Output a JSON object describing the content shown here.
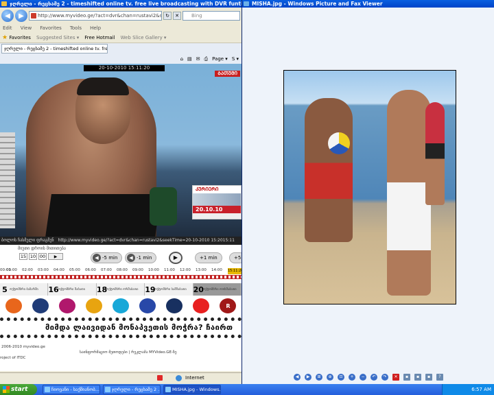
{
  "ie": {
    "title": "ჯღრელი - რეცხამე 2 - timeshifted online tv. free live broadcasting with DVR funtionality myvid - Windows Internet Explorer",
    "url": "http://www.myvideo.ge/?act=dvr&chan=rustavi2&seekTi",
    "search_placeholder": "Bing",
    "menu": [
      "Edit",
      "View",
      "Favorites",
      "Tools",
      "Help"
    ],
    "favorites_label": "Favorites",
    "fav_links": [
      "Suggested Sites ▾",
      "Free Hotmail",
      "Web Slice Gallery ▾"
    ],
    "tab_title": "ჯღრელი - რეცხამე 2 - timeshifted online tv. free live ...",
    "cmd": [
      "Page ▾",
      "S ▾"
    ],
    "status_zone": "Internet"
  },
  "player": {
    "timestamp": "20-10-2010  15:11:20",
    "badge": "ᲑᲐᲗᲣᲛᲘ",
    "corner_top": "ᲙᲣᲠᲘᲔᲠᲘ",
    "corner_date": "20.10.10",
    "ctrl_text": "ბოლოს ჩასმული ფრაგმენ",
    "ctrl_url": "http://www.myvideo.ge/?act=dvr&chan=rustavi2&seekTime=20-10-2010 15:2015:11",
    "time_label": "მიუთი დროის მითითება",
    "time_h": "15",
    "time_m": "10",
    "time_s": "00",
    "go": "▶",
    "btn_m5": "-5 min",
    "btn_m1": "-1 min",
    "btn_p1": "+1 min",
    "btn_p5": "+5"
  },
  "timeline": {
    "labels": [
      "00:00",
      "01:00",
      "02:00",
      "03:00",
      "04:00",
      "05:00",
      "06:00",
      "07:00",
      "08:00",
      "09:00",
      "10:00",
      "11:00",
      "12:00",
      "13:00",
      "14:00"
    ],
    "current": "15:11:20"
  },
  "programs": [
    {
      "num": "5",
      "text": "ოქტომბრი ბაზარში"
    },
    {
      "num": "16",
      "text": "ოქტომბრი შაბათი"
    },
    {
      "num": "18",
      "text": "ოქტომბრი ორშაბათი"
    },
    {
      "num": "19",
      "text": "ოქტომბრი სამშაბათი"
    },
    {
      "num": "20",
      "text": "ოქტომბრი ოთხშაბათი"
    }
  ],
  "channels": [
    {
      "label": "",
      "color": "#e8661c"
    },
    {
      "label": "",
      "color": "#203c78"
    },
    {
      "label": "",
      "color": "#b0186c"
    },
    {
      "label": "",
      "color": "#e8a410"
    },
    {
      "label": "",
      "color": "#18a8d8"
    },
    {
      "label": "",
      "color": "#2848a8"
    },
    {
      "label": "",
      "color": "#183060"
    },
    {
      "label": "",
      "color": "#e82020"
    },
    {
      "label": "R",
      "color": "#a01818"
    }
  ],
  "ticker": "მიმდა ლაივიდან მონაპვეთის მოჭრა? ჩაირთ",
  "footer": {
    "copy": "2006-2010 myvideo.ge",
    "project": "roject of ITDC",
    "links": "საინფორმაციო მეთოდები  |  რეკლამა MYVideo.GE-ზე"
  },
  "viewer": {
    "title": "MISHA.jpg - Windows Picture and Fax Viewer",
    "toolbar": [
      "◀",
      "▶",
      "⊞",
      "⊕",
      "⊡",
      "+",
      "−",
      "↶",
      "↷",
      "✕",
      "▪",
      "▪",
      "▪",
      "?"
    ]
  },
  "taskbar": {
    "start": "start",
    "items": [
      "ჩიოვანი - საქმიანობ...",
      "ჯღრელი - რეცხამე 2 ...",
      "MISHA.jpg - Windows..."
    ],
    "lang": "EN",
    "clock": "6:57 AM"
  }
}
